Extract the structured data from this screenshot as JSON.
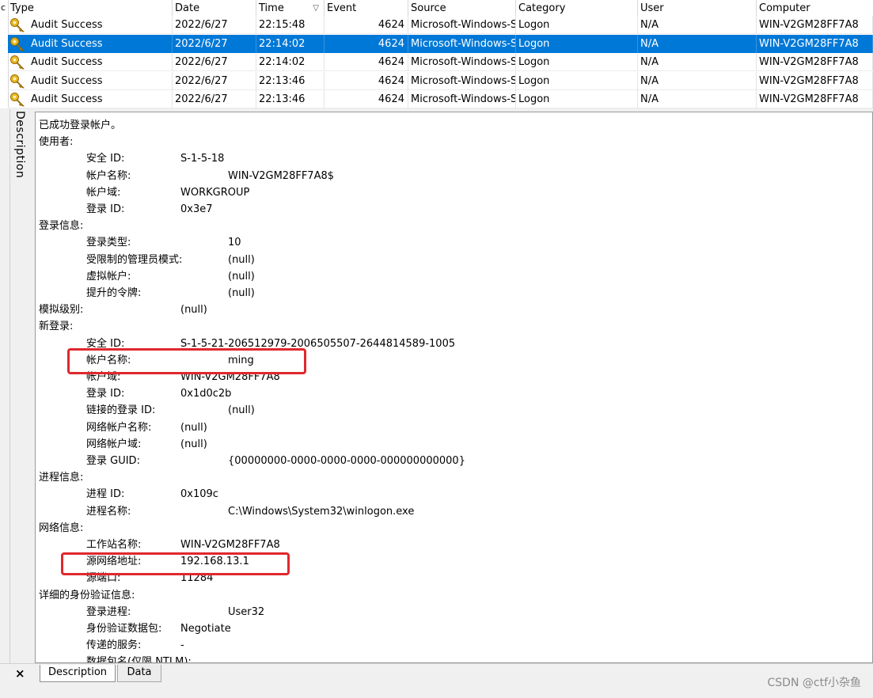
{
  "header": {
    "stub_label": "c",
    "columns": [
      "Type",
      "Date",
      "Time",
      "Event",
      "Source",
      "Category",
      "User",
      "Computer"
    ],
    "sort_icon": "▽"
  },
  "rows": [
    {
      "type": "Audit Success",
      "date": "2022/6/27",
      "time": "22:15:48",
      "event": "4624",
      "source": "Microsoft-Windows-Se",
      "category": "Logon",
      "user": "N/A",
      "computer": "WIN-V2GM28FF7A8"
    },
    {
      "type": "Audit Success",
      "date": "2022/6/27",
      "time": "22:14:02",
      "event": "4624",
      "source": "Microsoft-Windows-Se",
      "category": "Logon",
      "user": "N/A",
      "computer": "WIN-V2GM28FF7A8"
    },
    {
      "type": "Audit Success",
      "date": "2022/6/27",
      "time": "22:14:02",
      "event": "4624",
      "source": "Microsoft-Windows-Se",
      "category": "Logon",
      "user": "N/A",
      "computer": "WIN-V2GM28FF7A8"
    },
    {
      "type": "Audit Success",
      "date": "2022/6/27",
      "time": "22:13:46",
      "event": "4624",
      "source": "Microsoft-Windows-Se",
      "category": "Logon",
      "user": "N/A",
      "computer": "WIN-V2GM28FF7A8"
    },
    {
      "type": "Audit Success",
      "date": "2022/6/27",
      "time": "22:13:46",
      "event": "4624",
      "source": "Microsoft-Windows-Se",
      "category": "Logon",
      "user": "N/A",
      "computer": "WIN-V2GM28FF7A8"
    }
  ],
  "colors": {
    "selected_row": "#0078d7",
    "highlight_box": "#e0282e",
    "key_icon": "#d4a017"
  },
  "side_tab_label": "Description",
  "description": {
    "title": "已成功登录帐户。",
    "sections": [
      {
        "kind": "section",
        "label": "使用者:"
      },
      {
        "kind": "field",
        "label": "安全 ID:",
        "value": "S-1-5-18"
      },
      {
        "kind": "field",
        "label": "帐户名称:",
        "value": "WIN-V2GM28FF7A8$"
      },
      {
        "kind": "field",
        "label": "帐户域:",
        "value": "WORKGROUP"
      },
      {
        "kind": "field",
        "label": "登录 ID:",
        "value": "0x3e7"
      },
      {
        "kind": "section",
        "label": "登录信息:"
      },
      {
        "kind": "field",
        "label": "登录类型:",
        "value": "10"
      },
      {
        "kind": "field",
        "label": "受限制的管理员模式:",
        "value": "(null)"
      },
      {
        "kind": "field",
        "label": "虚拟帐户:",
        "value": "(null)"
      },
      {
        "kind": "field",
        "label": "提升的令牌:",
        "value": "(null)"
      },
      {
        "kind": "section",
        "label": "模拟级别:",
        "value": "(null)"
      },
      {
        "kind": "section",
        "label": "新登录:"
      },
      {
        "kind": "field",
        "label": "安全 ID:",
        "value": "S-1-5-21-206512979-2006505507-2644814589-1005"
      },
      {
        "kind": "field",
        "label": "帐户名称:",
        "value": "ming"
      },
      {
        "kind": "field",
        "label": "帐户域:",
        "value": "WIN-V2GM28FF7A8"
      },
      {
        "kind": "field",
        "label": "登录 ID:",
        "value": "0x1d0c2b"
      },
      {
        "kind": "field",
        "label": "链接的登录 ID:",
        "value": "(null)"
      },
      {
        "kind": "field",
        "label": "网络帐户名称:",
        "value": "(null)"
      },
      {
        "kind": "field",
        "label": "网络帐户域:",
        "value": "(null)"
      },
      {
        "kind": "field",
        "label": "登录 GUID:",
        "value": "{00000000-0000-0000-0000-000000000000}"
      },
      {
        "kind": "section",
        "label": "进程信息:"
      },
      {
        "kind": "field",
        "label": "进程 ID:",
        "value": "0x109c"
      },
      {
        "kind": "field",
        "label": "进程名称:",
        "value": "C:\\Windows\\System32\\winlogon.exe"
      },
      {
        "kind": "section",
        "label": "网络信息:"
      },
      {
        "kind": "field",
        "label": "工作站名称:",
        "value": "WIN-V2GM28FF7A8"
      },
      {
        "kind": "field",
        "label": "源网络地址:",
        "value": "192.168.13.1"
      },
      {
        "kind": "field",
        "label": "源端口:",
        "value": "11284"
      },
      {
        "kind": "section",
        "label": "详细的身份验证信息:"
      },
      {
        "kind": "field",
        "label": "登录进程:",
        "value": "User32"
      },
      {
        "kind": "field",
        "label": "身份验证数据包:",
        "value": "Negotiate"
      },
      {
        "kind": "field",
        "label": "传递的服务:",
        "value": "-"
      },
      {
        "kind": "field",
        "label": "数据包名(仅限 NTLM):",
        "value": ""
      }
    ]
  },
  "tabs": {
    "description": "Description",
    "data": "Data"
  },
  "close_icon": "×",
  "watermark": "CSDN @ctf小杂鱼"
}
